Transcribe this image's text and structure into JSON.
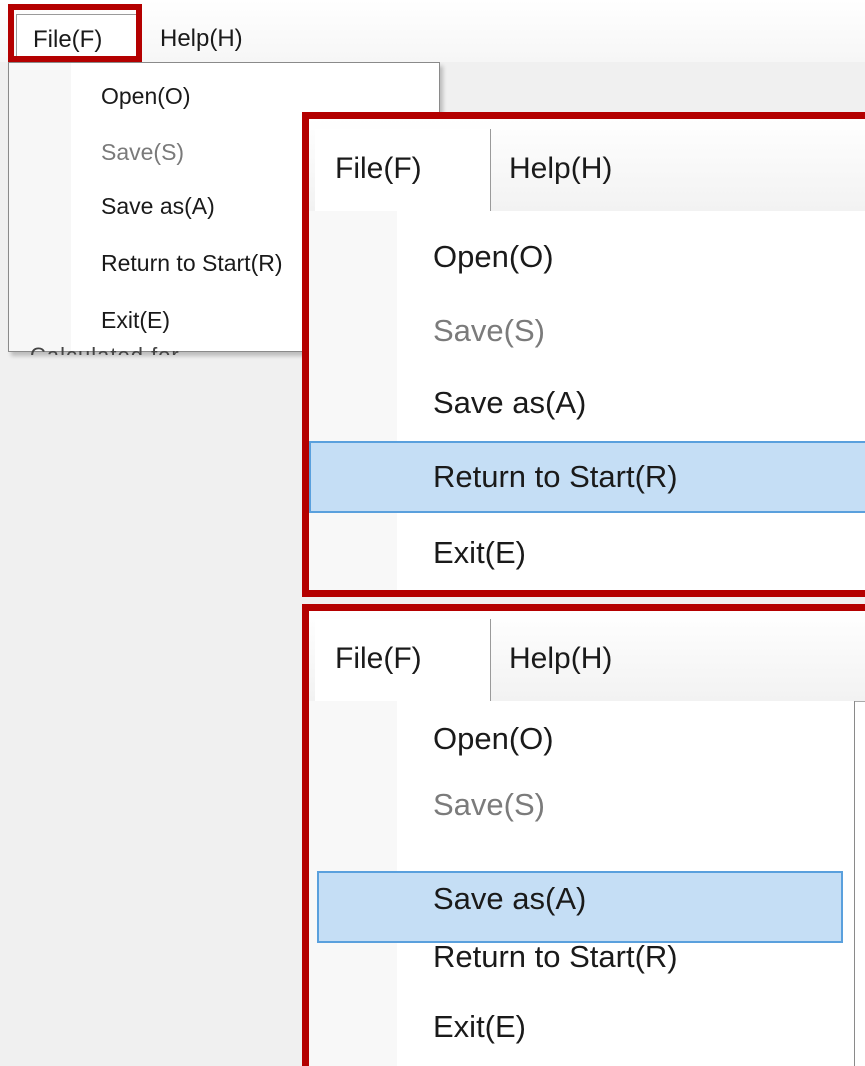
{
  "menubar": {
    "file_label": "File(F)",
    "help_label": "Help(H)"
  },
  "menu_items": [
    {
      "label": "Open(O)",
      "enabled": true
    },
    {
      "label": "Save(S)",
      "enabled": false
    },
    {
      "label": "Save as(A)",
      "enabled": true
    },
    {
      "label": "Return to Start(R)",
      "enabled": true
    },
    {
      "label": "Exit(E)",
      "enabled": true
    }
  ],
  "background_text": "Calculated for",
  "colors": {
    "highlight_box": "#b40000",
    "selection_fill": "#c5def5",
    "selection_border": "#5aa0dd",
    "disabled_text": "#7a7a7a"
  },
  "panel2": {
    "highlighted_item": "Return to Start(R)"
  },
  "panel3": {
    "highlighted_item": "Save as(A)"
  }
}
